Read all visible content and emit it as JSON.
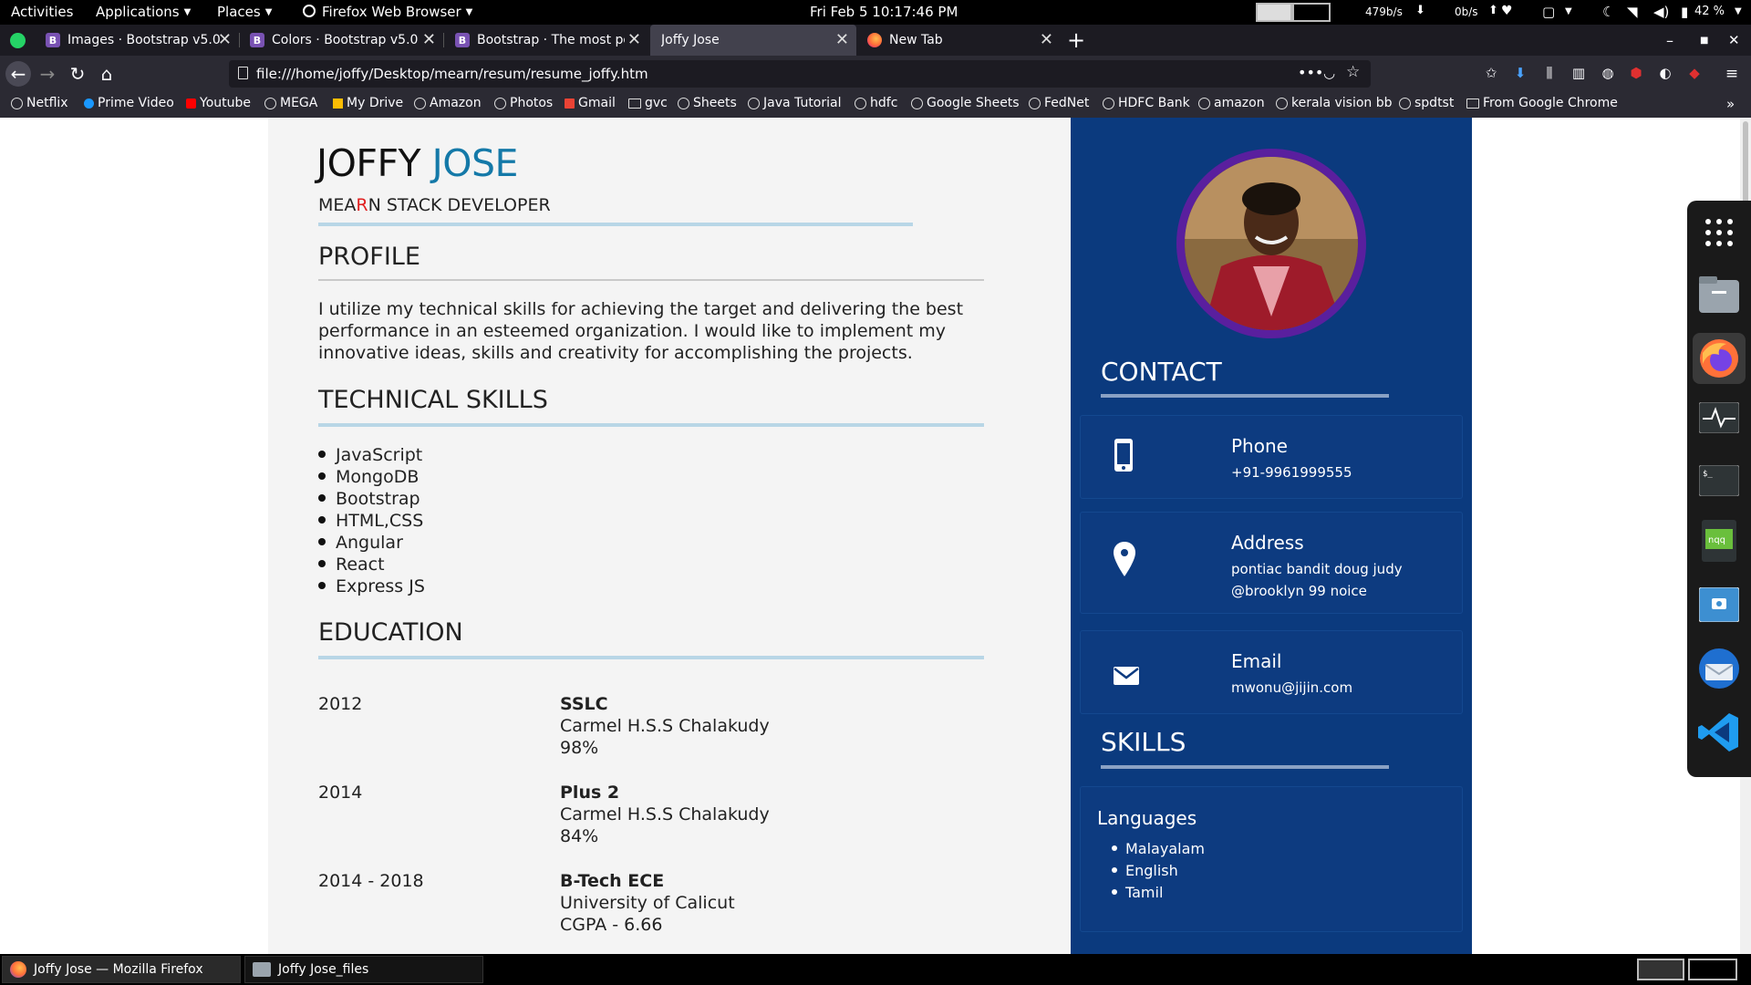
{
  "topbar": {
    "activities": "Activities",
    "applications": "Applications",
    "places": "Places",
    "app_menu": "Firefox Web Browser",
    "clock": "Fri Feb 5  10:17:46 PM",
    "net_down": "479b/s",
    "net_up": "0b/s",
    "battery": "42 %"
  },
  "tabs": [
    {
      "label": "Images · Bootstrap v5.0",
      "favicon": "B"
    },
    {
      "label": "Colors · Bootstrap v5.0",
      "favicon": "B"
    },
    {
      "label": "Bootstrap · The most po",
      "favicon": "B"
    },
    {
      "label": "Joffy Jose",
      "favicon": ""
    },
    {
      "label": "New Tab",
      "favicon": "firefox"
    }
  ],
  "urlbar": {
    "url": "file:///home/joffy/Desktop/mearn/resum/resume_joffy.htm"
  },
  "bookmarks": [
    "Netflix",
    "Prime Video",
    "Youtube",
    "MEGA",
    "My Drive",
    "Amazon",
    "Photos",
    "Gmail",
    "gvc",
    "Sheets",
    "Java Tutorial",
    "hdfc",
    "Google Sheets",
    "FedNet",
    "HDFC Bank",
    "amazon",
    "kerala vision bb",
    "spdtst",
    "From Google Chrome"
  ],
  "resume": {
    "first_name": "JOFFY",
    "last_name": "JOSE",
    "role_pre": "MEA",
    "role_r": "R",
    "role_post": "N STACK DEVELOPER",
    "profile_heading": "PROFILE",
    "profile_text": "I utilize my technical skills for achieving the target and delivering the best performance in an esteemed organization. I would like to implement my innovative ideas, skills and creativity for accomplishing the projects.",
    "skills_heading": "TECHNICAL SKILLS",
    "skills": [
      "JavaScript",
      "MongoDB",
      "Bootstrap",
      "HTML,CSS",
      "Angular",
      "React",
      "Express JS"
    ],
    "education_heading": "EDUCATION",
    "education": [
      {
        "year": "2012",
        "degree": "SSLC",
        "school": "Carmel H.S.S Chalakudy",
        "score": "98%"
      },
      {
        "year": "2014",
        "degree": "Plus 2",
        "school": "Carmel H.S.S Chalakudy",
        "score": "84%"
      },
      {
        "year": "2014 - 2018",
        "degree": "B-Tech ECE",
        "school": "University of Calicut",
        "score": "CGPA - 6.66"
      }
    ],
    "contact_heading": "CONTACT",
    "phone_label": "Phone",
    "phone": "+91-9961999555",
    "address_label": "Address",
    "address_line1": "pontiac bandit doug judy",
    "address_line2": "@brooklyn 99 noice",
    "email_label": "Email",
    "email": "mwonu@jijin.com",
    "skills2_heading": "SKILLS",
    "languages_heading": "Languages",
    "languages": [
      "Malayalam",
      "English",
      "Tamil"
    ]
  },
  "taskbar": [
    {
      "label": "Joffy Jose — Mozilla Firefox"
    },
    {
      "label": "Joffy Jose_files"
    }
  ],
  "colors": {
    "sidebar_blue": "#0b3a7e",
    "accent_blue": "#1479a8",
    "photo_ring": "#5a1f9e"
  }
}
